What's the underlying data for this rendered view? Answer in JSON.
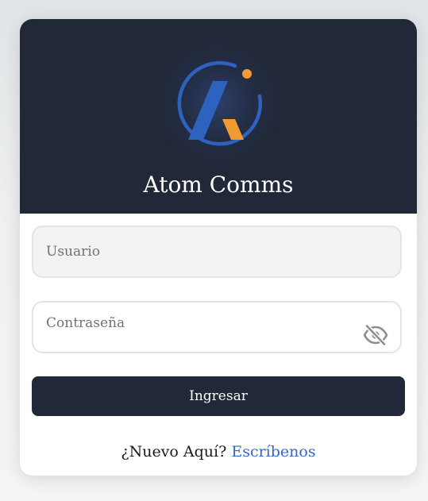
{
  "brand": {
    "title": "Atom Comms",
    "logo_icon": "atom-comms-logo-icon",
    "colors": {
      "header_bg": "#212838",
      "logo_blue": "#2d63bf",
      "logo_orange": "#f29b33",
      "link": "#3268c4"
    }
  },
  "login_form": {
    "username": {
      "placeholder": "Usuario",
      "value": ""
    },
    "password": {
      "placeholder": "Contraseña",
      "value": "",
      "toggle_icon": "eye-slash-icon"
    },
    "submit_label": "Ingresar"
  },
  "footer": {
    "prompt": "¿Nuevo Aquí?",
    "link_label": "Escríbenos"
  }
}
